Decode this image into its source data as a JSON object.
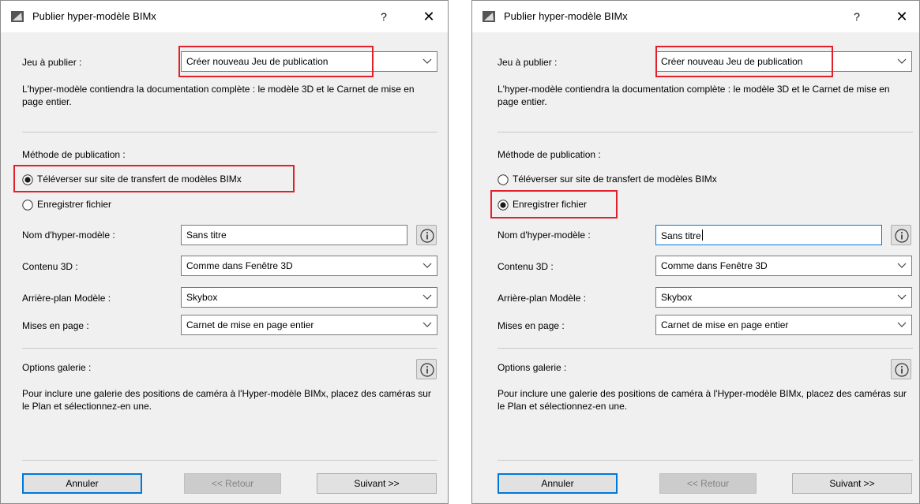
{
  "dialogs": [
    {
      "title": "Publier hyper-modèle BIMx",
      "help": "?",
      "close": "✕",
      "set_label": "Jeu à publier :",
      "set_value": "Créer nouveau Jeu de publication",
      "description": "L'hyper-modèle contiendra la documentation complète : le modèle 3D et le Carnet de mise en page entier.",
      "method_label": "Méthode de publication :",
      "radio_upload": "Téléverser sur site de transfert de modèles BIMx",
      "radio_save": "Enregistrer fichier",
      "selected_method": "upload",
      "name_label": "Nom d'hyper-modèle :",
      "name_value": "Sans titre",
      "content_label": "Contenu 3D :",
      "content_value": "Comme dans Fenêtre 3D",
      "background_label": "Arrière-plan Modèle :",
      "background_value": "Skybox",
      "layouts_label": "Mises en page :",
      "layouts_value": "Carnet de mise en page entier",
      "gallery_label": "Options galerie :",
      "gallery_text": "Pour inclure une galerie des positions de caméra à l'Hyper-modèle BIMx, placez des caméras sur le Plan et sélectionnez-en une.",
      "cancel": "Annuler",
      "back": "<< Retour",
      "next": "Suivant >>"
    },
    {
      "title": "Publier hyper-modèle BIMx",
      "help": "?",
      "close": "✕",
      "set_label": "Jeu à publier :",
      "set_value": "Créer nouveau Jeu de publication",
      "description": "L'hyper-modèle contiendra la documentation complète : le modèle 3D et le Carnet de mise en page entier.",
      "method_label": "Méthode de publication :",
      "radio_upload": "Téléverser sur site de transfert de modèles BIMx",
      "radio_save": "Enregistrer fichier",
      "selected_method": "save",
      "name_label": "Nom d'hyper-modèle :",
      "name_value": "Sans titre",
      "content_label": "Contenu 3D :",
      "content_value": "Comme dans Fenêtre 3D",
      "background_label": "Arrière-plan Modèle :",
      "background_value": "Skybox",
      "layouts_label": "Mises en page :",
      "layouts_value": "Carnet de mise en page entier",
      "gallery_label": "Options galerie :",
      "gallery_text": "Pour inclure une galerie des positions de caméra à l'Hyper-modèle BIMx, placez des caméras sur le Plan et sélectionnez-en une.",
      "cancel": "Annuler",
      "back": "<< Retour",
      "next": "Suivant >>"
    }
  ],
  "colors": {
    "highlight": "#e0202a",
    "focus": "#0078d7"
  }
}
